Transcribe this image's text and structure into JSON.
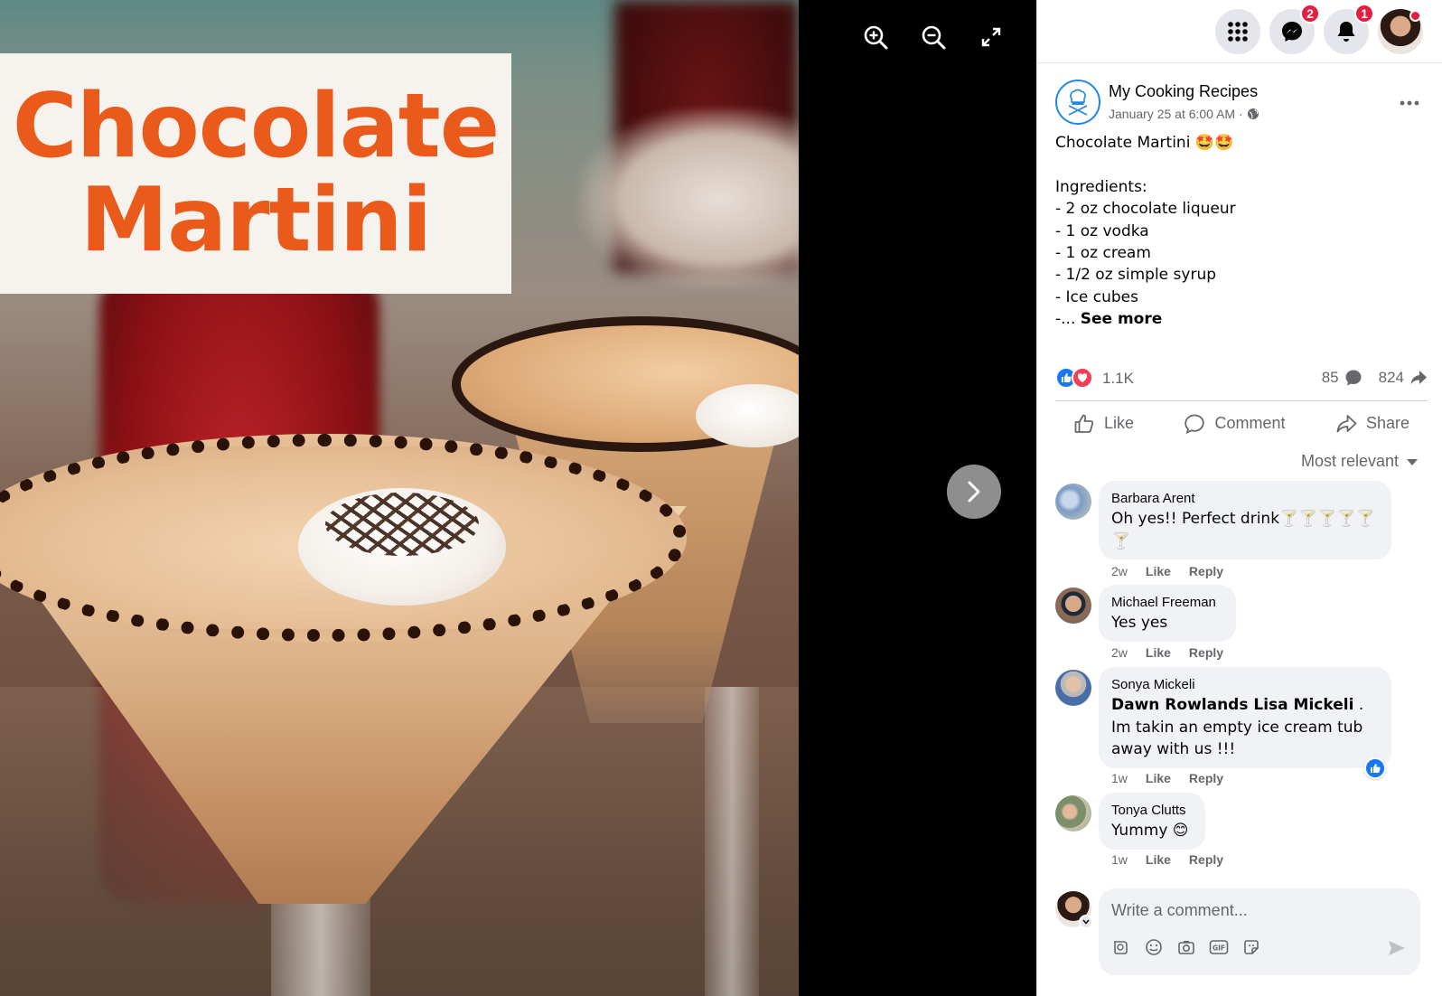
{
  "viewer": {
    "image_title_line1": "Chocolate",
    "image_title_line2": "Martini",
    "tools": [
      "zoom-in-icon",
      "zoom-out-icon",
      "fullscreen-icon"
    ],
    "next_icon": "chevron-right-icon"
  },
  "topbar": {
    "messenger_badge": "2",
    "notifications_badge": "1"
  },
  "post": {
    "page_name": "My Cooking Recipes",
    "timestamp": "January 25 at 6:00 AM ·",
    "privacy_icon": "globe-icon",
    "lines": [
      "Chocolate Martini 🤩🤩",
      "",
      "Ingredients:",
      "- 2 oz chocolate liqueur",
      "- 1 oz vodka",
      "- 1 oz cream",
      "- 1/2 oz simple syrup",
      "- Ice cubes"
    ],
    "truncated_prefix": "-... ",
    "see_more": "See more",
    "reaction_count": "1.1K",
    "comment_count": "85",
    "share_count": "824",
    "actions": {
      "like": "Like",
      "comment": "Comment",
      "share": "Share"
    },
    "sort_label": "Most relevant"
  },
  "comments": [
    {
      "author": "Barbara Arent",
      "text": "Oh yes!! Perfect drink🍸🍸🍸🍸🍸🍸",
      "time": "2w",
      "like": "Like",
      "reply": "Reply"
    },
    {
      "author": "Michael Freeman",
      "text": "Yes yes",
      "time": "2w",
      "like": "Like",
      "reply": "Reply"
    },
    {
      "author": "Sonya Mickeli",
      "mention": "Dawn Rowlands Lisa Mickeli",
      "text": " . Im takin an empty ice cream tub away with us !!!",
      "time": "1w",
      "like": "Like",
      "reply": "Reply"
    },
    {
      "author": "Tonya Clutts",
      "text": "Yummy 😊",
      "time": "1w",
      "like": "Like",
      "reply": "Reply"
    }
  ],
  "composer": {
    "placeholder": "Write a comment...",
    "tools": [
      "avatar-sticker-icon",
      "emoji-icon",
      "camera-icon",
      "gif-icon",
      "sticker-icon"
    ],
    "send_icon": "send-icon"
  },
  "colors": {
    "accent": "#1877f2",
    "title_orange": "#ea5a1b",
    "badge_red": "#e41e3f",
    "love_red": "#f33e58"
  }
}
